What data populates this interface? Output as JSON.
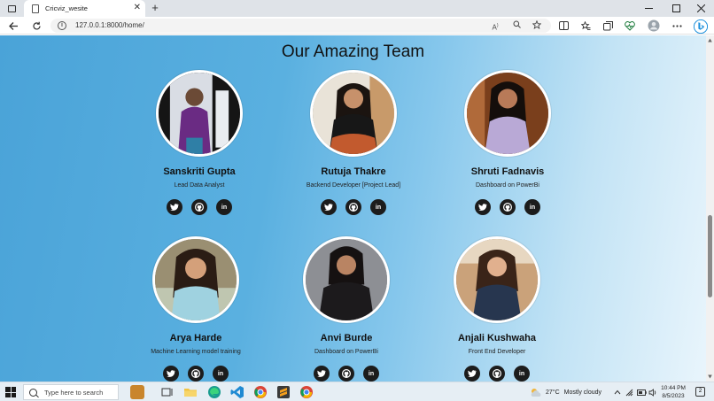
{
  "browser": {
    "tab_title": "Cricviz_wesite",
    "url": "127.0.0.1:8000/home/",
    "tab_close_glyph": "✕",
    "new_tab_glyph": "+"
  },
  "page": {
    "section_title": "Our Amazing Team",
    "members": [
      {
        "name": "Sanskriti Gupta",
        "role": "Lead Data Analyst"
      },
      {
        "name": "Rutuja Thakre",
        "role": "Backend Developer [Project Lead]"
      },
      {
        "name": "Shruti Fadnavis",
        "role": "Dashboard on PowerBi"
      },
      {
        "name": "Arya Harde",
        "role": "Machine Learning model training"
      },
      {
        "name": "Anvi Burde",
        "role": "Dashboard on PowerBi"
      },
      {
        "name": "Anjali Kushwaha",
        "role": "Front End Developer"
      }
    ],
    "social_icons": [
      "twitter-icon",
      "github-icon",
      "linkedin-icon"
    ]
  },
  "taskbar": {
    "search_placeholder": "Type here to search",
    "weather_temp": "27°C",
    "weather_text": "Mostly cloudy",
    "time": "10:44 PM",
    "date": "8/5/2023"
  },
  "colors": {
    "page_gradient_start": "#4aa3d8",
    "page_gradient_end": "#e9f5fc",
    "social_button": "#1c1c1c"
  }
}
